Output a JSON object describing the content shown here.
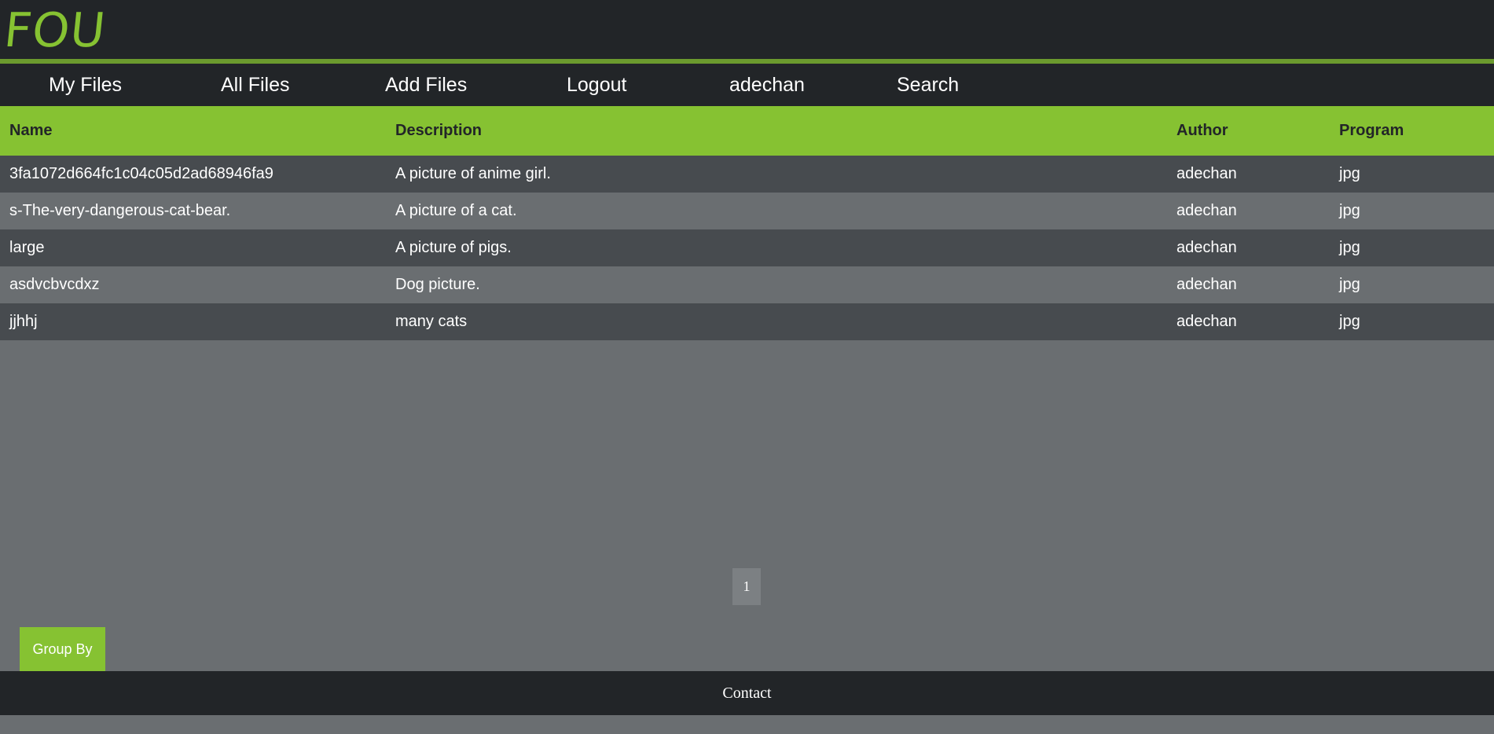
{
  "app": {
    "logo": "FOU"
  },
  "nav": {
    "items": [
      {
        "label": "My Files"
      },
      {
        "label": "All Files"
      },
      {
        "label": "Add Files"
      },
      {
        "label": "Logout"
      },
      {
        "label": "adechan"
      },
      {
        "label": "Search"
      }
    ]
  },
  "table": {
    "columns": [
      "Name",
      "Description",
      "Author",
      "Program"
    ],
    "rows": [
      [
        "3fa1072d664fc1c04c05d2ad68946fa9",
        "A picture of anime girl.",
        "adechan",
        "jpg"
      ],
      [
        "s-The-very-dangerous-cat-bear.",
        "A picture of a cat.",
        "adechan",
        "jpg"
      ],
      [
        "large",
        "A picture of pigs.",
        "adechan",
        "jpg"
      ],
      [
        "asdvcbvcdxz",
        "Dog picture.",
        "adechan",
        "jpg"
      ],
      [
        "jjhhj",
        "many cats",
        "adechan",
        "jpg"
      ]
    ]
  },
  "pagination": {
    "current_page": "1"
  },
  "controls": {
    "group_by_label": "Group By"
  },
  "footer": {
    "contact_label": "Contact"
  },
  "colors": {
    "accent": "#86c232",
    "dark": "#222528",
    "row_dark": "#474b4f",
    "row_light": "#6a6e71"
  }
}
